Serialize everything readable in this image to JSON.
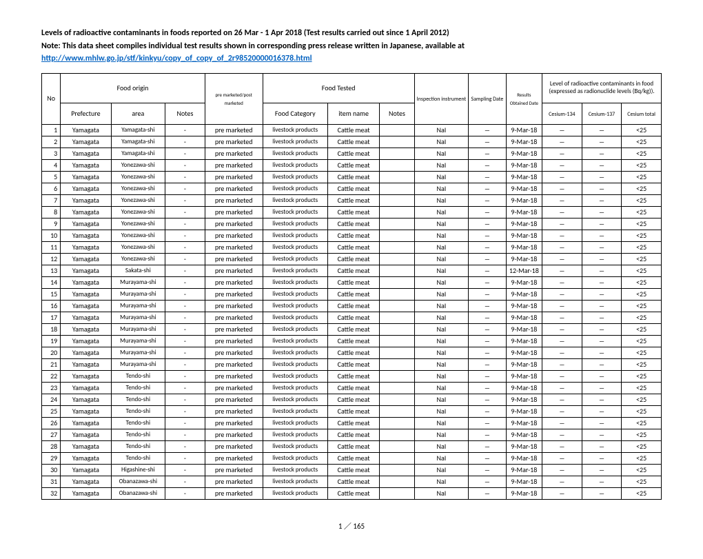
{
  "header": {
    "line1": "Levels of radioactive contaminants in foods reported on 26 Mar - 1 Apr 2018 (Test results carried out since 1 April 2012)",
    "line2": "Note: This data sheet compiles individual test results shown in corresponding press release written in Japanese, available at",
    "link": "http://www.mhlw.go.jp/stf/kinkyu/copy_of_copy_of_2r98520000016378.html"
  },
  "columns": {
    "group_food_origin": "Food origin",
    "group_food_tested": "Food Tested",
    "group_levels": "Level of radioactive contaminants in food (expressed as radionuclide levels (Bq/kg)).",
    "no": "No",
    "prefecture": "Prefecture",
    "area": "area",
    "notes1": "Notes",
    "market": "pre marketed/post marketed",
    "category": "Food Category",
    "item": "item name",
    "notes2": "Notes",
    "instrument": "Inspection instrument",
    "sampling": "Sampling Date",
    "results_date": "Results Obtained Date",
    "cs134": "Cesium-134",
    "cs137": "Cesium-137",
    "cstotal": "Cesium total"
  },
  "rows": [
    {
      "no": 1,
      "prefecture": "Yamagata",
      "area": "Yamagata-shi",
      "notes1": "-",
      "market": "pre marketed",
      "category": "livestock products",
      "item": "Cattle meat",
      "notes2": "",
      "instrument": "NaI",
      "sampling": "―",
      "results": "9-Mar-18",
      "cs134": "―",
      "cs137": "―",
      "cstotal": "<25"
    },
    {
      "no": 2,
      "prefecture": "Yamagata",
      "area": "Yamagata-shi",
      "notes1": "-",
      "market": "pre marketed",
      "category": "livestock products",
      "item": "Cattle meat",
      "notes2": "",
      "instrument": "NaI",
      "sampling": "―",
      "results": "9-Mar-18",
      "cs134": "―",
      "cs137": "―",
      "cstotal": "<25"
    },
    {
      "no": 3,
      "prefecture": "Yamagata",
      "area": "Yamagata-shi",
      "notes1": "-",
      "market": "pre marketed",
      "category": "livestock products",
      "item": "Cattle meat",
      "notes2": "",
      "instrument": "NaI",
      "sampling": "―",
      "results": "9-Mar-18",
      "cs134": "―",
      "cs137": "―",
      "cstotal": "<25"
    },
    {
      "no": 4,
      "prefecture": "Yamagata",
      "area": "Yonezawa-shi",
      "notes1": "-",
      "market": "pre marketed",
      "category": "livestock products",
      "item": "Cattle meat",
      "notes2": "",
      "instrument": "NaI",
      "sampling": "―",
      "results": "9-Mar-18",
      "cs134": "―",
      "cs137": "―",
      "cstotal": "<25"
    },
    {
      "no": 5,
      "prefecture": "Yamagata",
      "area": "Yonezawa-shi",
      "notes1": "-",
      "market": "pre marketed",
      "category": "livestock products",
      "item": "Cattle meat",
      "notes2": "",
      "instrument": "NaI",
      "sampling": "―",
      "results": "9-Mar-18",
      "cs134": "―",
      "cs137": "―",
      "cstotal": "<25"
    },
    {
      "no": 6,
      "prefecture": "Yamagata",
      "area": "Yonezawa-shi",
      "notes1": "-",
      "market": "pre marketed",
      "category": "livestock products",
      "item": "Cattle meat",
      "notes2": "",
      "instrument": "NaI",
      "sampling": "―",
      "results": "9-Mar-18",
      "cs134": "―",
      "cs137": "―",
      "cstotal": "<25"
    },
    {
      "no": 7,
      "prefecture": "Yamagata",
      "area": "Yonezawa-shi",
      "notes1": "-",
      "market": "pre marketed",
      "category": "livestock products",
      "item": "Cattle meat",
      "notes2": "",
      "instrument": "NaI",
      "sampling": "―",
      "results": "9-Mar-18",
      "cs134": "―",
      "cs137": "―",
      "cstotal": "<25"
    },
    {
      "no": 8,
      "prefecture": "Yamagata",
      "area": "Yonezawa-shi",
      "notes1": "-",
      "market": "pre marketed",
      "category": "livestock products",
      "item": "Cattle meat",
      "notes2": "",
      "instrument": "NaI",
      "sampling": "―",
      "results": "9-Mar-18",
      "cs134": "―",
      "cs137": "―",
      "cstotal": "<25"
    },
    {
      "no": 9,
      "prefecture": "Yamagata",
      "area": "Yonezawa-shi",
      "notes1": "-",
      "market": "pre marketed",
      "category": "livestock products",
      "item": "Cattle meat",
      "notes2": "",
      "instrument": "NaI",
      "sampling": "―",
      "results": "9-Mar-18",
      "cs134": "―",
      "cs137": "―",
      "cstotal": "<25"
    },
    {
      "no": 10,
      "prefecture": "Yamagata",
      "area": "Yonezawa-shi",
      "notes1": "-",
      "market": "pre marketed",
      "category": "livestock products",
      "item": "Cattle meat",
      "notes2": "",
      "instrument": "NaI",
      "sampling": "―",
      "results": "9-Mar-18",
      "cs134": "―",
      "cs137": "―",
      "cstotal": "<25"
    },
    {
      "no": 11,
      "prefecture": "Yamagata",
      "area": "Yonezawa-shi",
      "notes1": "-",
      "market": "pre marketed",
      "category": "livestock products",
      "item": "Cattle meat",
      "notes2": "",
      "instrument": "NaI",
      "sampling": "―",
      "results": "9-Mar-18",
      "cs134": "―",
      "cs137": "―",
      "cstotal": "<25"
    },
    {
      "no": 12,
      "prefecture": "Yamagata",
      "area": "Yonezawa-shi",
      "notes1": "-",
      "market": "pre marketed",
      "category": "livestock products",
      "item": "Cattle meat",
      "notes2": "",
      "instrument": "NaI",
      "sampling": "―",
      "results": "9-Mar-18",
      "cs134": "―",
      "cs137": "―",
      "cstotal": "<25"
    },
    {
      "no": 13,
      "prefecture": "Yamagata",
      "area": "Sakata-shi",
      "notes1": "-",
      "market": "pre marketed",
      "category": "livestock products",
      "item": "Cattle meat",
      "notes2": "",
      "instrument": "NaI",
      "sampling": "―",
      "results": "12-Mar-18",
      "cs134": "―",
      "cs137": "―",
      "cstotal": "<25"
    },
    {
      "no": 14,
      "prefecture": "Yamagata",
      "area": "Murayama-shi",
      "notes1": "-",
      "market": "pre marketed",
      "category": "livestock products",
      "item": "Cattle meat",
      "notes2": "",
      "instrument": "NaI",
      "sampling": "―",
      "results": "9-Mar-18",
      "cs134": "―",
      "cs137": "―",
      "cstotal": "<25"
    },
    {
      "no": 15,
      "prefecture": "Yamagata",
      "area": "Murayama-shi",
      "notes1": "-",
      "market": "pre marketed",
      "category": "livestock products",
      "item": "Cattle meat",
      "notes2": "",
      "instrument": "NaI",
      "sampling": "―",
      "results": "9-Mar-18",
      "cs134": "―",
      "cs137": "―",
      "cstotal": "<25"
    },
    {
      "no": 16,
      "prefecture": "Yamagata",
      "area": "Murayama-shi",
      "notes1": "-",
      "market": "pre marketed",
      "category": "livestock products",
      "item": "Cattle meat",
      "notes2": "",
      "instrument": "NaI",
      "sampling": "―",
      "results": "9-Mar-18",
      "cs134": "―",
      "cs137": "―",
      "cstotal": "<25"
    },
    {
      "no": 17,
      "prefecture": "Yamagata",
      "area": "Murayama-shi",
      "notes1": "-",
      "market": "pre marketed",
      "category": "livestock products",
      "item": "Cattle meat",
      "notes2": "",
      "instrument": "NaI",
      "sampling": "―",
      "results": "9-Mar-18",
      "cs134": "―",
      "cs137": "―",
      "cstotal": "<25"
    },
    {
      "no": 18,
      "prefecture": "Yamagata",
      "area": "Murayama-shi",
      "notes1": "-",
      "market": "pre marketed",
      "category": "livestock products",
      "item": "Cattle meat",
      "notes2": "",
      "instrument": "NaI",
      "sampling": "―",
      "results": "9-Mar-18",
      "cs134": "―",
      "cs137": "―",
      "cstotal": "<25"
    },
    {
      "no": 19,
      "prefecture": "Yamagata",
      "area": "Murayama-shi",
      "notes1": "-",
      "market": "pre marketed",
      "category": "livestock products",
      "item": "Cattle meat",
      "notes2": "",
      "instrument": "NaI",
      "sampling": "―",
      "results": "9-Mar-18",
      "cs134": "―",
      "cs137": "―",
      "cstotal": "<25"
    },
    {
      "no": 20,
      "prefecture": "Yamagata",
      "area": "Murayama-shi",
      "notes1": "-",
      "market": "pre marketed",
      "category": "livestock products",
      "item": "Cattle meat",
      "notes2": "",
      "instrument": "NaI",
      "sampling": "―",
      "results": "9-Mar-18",
      "cs134": "―",
      "cs137": "―",
      "cstotal": "<25"
    },
    {
      "no": 21,
      "prefecture": "Yamagata",
      "area": "Murayama-shi",
      "notes1": "-",
      "market": "pre marketed",
      "category": "livestock products",
      "item": "Cattle meat",
      "notes2": "",
      "instrument": "NaI",
      "sampling": "―",
      "results": "9-Mar-18",
      "cs134": "―",
      "cs137": "―",
      "cstotal": "<25"
    },
    {
      "no": 22,
      "prefecture": "Yamagata",
      "area": "Tendo-shi",
      "notes1": "-",
      "market": "pre marketed",
      "category": "livestock products",
      "item": "Cattle meat",
      "notes2": "",
      "instrument": "NaI",
      "sampling": "―",
      "results": "9-Mar-18",
      "cs134": "―",
      "cs137": "―",
      "cstotal": "<25"
    },
    {
      "no": 23,
      "prefecture": "Yamagata",
      "area": "Tendo-shi",
      "notes1": "-",
      "market": "pre marketed",
      "category": "livestock products",
      "item": "Cattle meat",
      "notes2": "",
      "instrument": "NaI",
      "sampling": "―",
      "results": "9-Mar-18",
      "cs134": "―",
      "cs137": "―",
      "cstotal": "<25"
    },
    {
      "no": 24,
      "prefecture": "Yamagata",
      "area": "Tendo-shi",
      "notes1": "-",
      "market": "pre marketed",
      "category": "livestock products",
      "item": "Cattle meat",
      "notes2": "",
      "instrument": "NaI",
      "sampling": "―",
      "results": "9-Mar-18",
      "cs134": "―",
      "cs137": "―",
      "cstotal": "<25"
    },
    {
      "no": 25,
      "prefecture": "Yamagata",
      "area": "Tendo-shi",
      "notes1": "-",
      "market": "pre marketed",
      "category": "livestock products",
      "item": "Cattle meat",
      "notes2": "",
      "instrument": "NaI",
      "sampling": "―",
      "results": "9-Mar-18",
      "cs134": "―",
      "cs137": "―",
      "cstotal": "<25"
    },
    {
      "no": 26,
      "prefecture": "Yamagata",
      "area": "Tendo-shi",
      "notes1": "-",
      "market": "pre marketed",
      "category": "livestock products",
      "item": "Cattle meat",
      "notes2": "",
      "instrument": "NaI",
      "sampling": "―",
      "results": "9-Mar-18",
      "cs134": "―",
      "cs137": "―",
      "cstotal": "<25"
    },
    {
      "no": 27,
      "prefecture": "Yamagata",
      "area": "Tendo-shi",
      "notes1": "-",
      "market": "pre marketed",
      "category": "livestock products",
      "item": "Cattle meat",
      "notes2": "",
      "instrument": "NaI",
      "sampling": "―",
      "results": "9-Mar-18",
      "cs134": "―",
      "cs137": "―",
      "cstotal": "<25"
    },
    {
      "no": 28,
      "prefecture": "Yamagata",
      "area": "Tendo-shi",
      "notes1": "-",
      "market": "pre marketed",
      "category": "livestock products",
      "item": "Cattle meat",
      "notes2": "",
      "instrument": "NaI",
      "sampling": "―",
      "results": "9-Mar-18",
      "cs134": "―",
      "cs137": "―",
      "cstotal": "<25"
    },
    {
      "no": 29,
      "prefecture": "Yamagata",
      "area": "Tendo-shi",
      "notes1": "-",
      "market": "pre marketed",
      "category": "livestock products",
      "item": "Cattle meat",
      "notes2": "",
      "instrument": "NaI",
      "sampling": "―",
      "results": "9-Mar-18",
      "cs134": "―",
      "cs137": "―",
      "cstotal": "<25"
    },
    {
      "no": 30,
      "prefecture": "Yamagata",
      "area": "Higashine-shi",
      "notes1": "-",
      "market": "pre marketed",
      "category": "livestock products",
      "item": "Cattle meat",
      "notes2": "",
      "instrument": "NaI",
      "sampling": "―",
      "results": "9-Mar-18",
      "cs134": "―",
      "cs137": "―",
      "cstotal": "<25"
    },
    {
      "no": 31,
      "prefecture": "Yamagata",
      "area": "Obanazawa-shi",
      "notes1": "-",
      "market": "pre marketed",
      "category": "livestock products",
      "item": "Cattle meat",
      "notes2": "",
      "instrument": "NaI",
      "sampling": "―",
      "results": "9-Mar-18",
      "cs134": "―",
      "cs137": "―",
      "cstotal": "<25"
    },
    {
      "no": 32,
      "prefecture": "Yamagata",
      "area": "Obanazawa-shi",
      "notes1": "-",
      "market": "pre marketed",
      "category": "livestock products",
      "item": "Cattle meat",
      "notes2": "",
      "instrument": "NaI",
      "sampling": "―",
      "results": "9-Mar-18",
      "cs134": "―",
      "cs137": "―",
      "cstotal": "<25"
    }
  ],
  "footer": "1 ／ 165"
}
